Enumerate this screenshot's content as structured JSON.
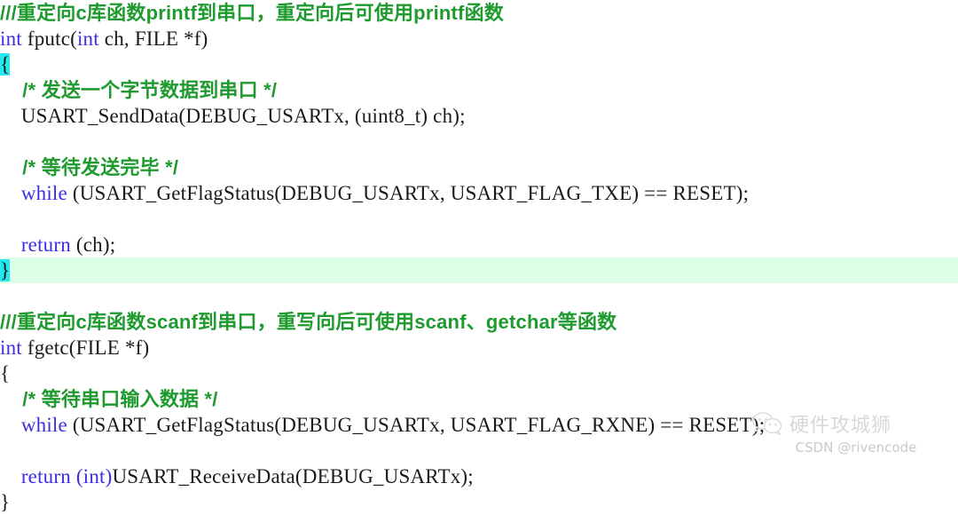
{
  "editor": {
    "background_color": "#ffffff",
    "highlight_line_color": "#ddffe6",
    "brace_match_color": "#22e8f0",
    "comment_color": "#1f9a2e",
    "keyword_color": "#3b2fe0",
    "text_color": "#1a1a1a",
    "language": "C"
  },
  "code": {
    "lines": [
      {
        "n": 1,
        "highlight": false,
        "tokens": [
          {
            "t": "comment",
            "s": "///重定向c库函数printf到串口，重定向后可使用printf函数"
          }
        ]
      },
      {
        "n": 2,
        "highlight": false,
        "tokens": [
          {
            "t": "keyword",
            "s": "int"
          },
          {
            "t": "plain",
            "s": " fputc("
          },
          {
            "t": "keyword",
            "s": "int"
          },
          {
            "t": "plain",
            "s": " ch, FILE *f)"
          }
        ]
      },
      {
        "n": 3,
        "highlight": false,
        "tokens": [
          {
            "t": "brace-hl",
            "s": "{"
          }
        ]
      },
      {
        "n": 4,
        "highlight": false,
        "tokens": [
          {
            "t": "comment",
            "s": "    /* 发送一个字节数据到串口 */"
          }
        ]
      },
      {
        "n": 5,
        "highlight": false,
        "tokens": [
          {
            "t": "plain",
            "s": "    USART_SendData(DEBUG_USARTx, (uint8_t) ch);"
          }
        ]
      },
      {
        "n": 6,
        "highlight": false,
        "tokens": [
          {
            "t": "plain",
            "s": " "
          }
        ]
      },
      {
        "n": 7,
        "highlight": false,
        "tokens": [
          {
            "t": "comment",
            "s": "    /* 等待发送完毕 */"
          }
        ]
      },
      {
        "n": 8,
        "highlight": false,
        "tokens": [
          {
            "t": "plain",
            "s": "    "
          },
          {
            "t": "keyword",
            "s": "while"
          },
          {
            "t": "plain",
            "s": " (USART_GetFlagStatus(DEBUG_USARTx, USART_FLAG_TXE) == RESET);"
          }
        ]
      },
      {
        "n": 9,
        "highlight": false,
        "tokens": [
          {
            "t": "plain",
            "s": " "
          }
        ]
      },
      {
        "n": 10,
        "highlight": false,
        "tokens": [
          {
            "t": "plain",
            "s": "    "
          },
          {
            "t": "keyword",
            "s": "return"
          },
          {
            "t": "plain",
            "s": " (ch);"
          }
        ]
      },
      {
        "n": 11,
        "highlight": true,
        "tokens": [
          {
            "t": "brace-hl",
            "s": "}"
          }
        ]
      },
      {
        "n": 12,
        "highlight": false,
        "tokens": [
          {
            "t": "plain",
            "s": " "
          }
        ]
      },
      {
        "n": 13,
        "highlight": false,
        "tokens": [
          {
            "t": "comment",
            "s": "///重定向c库函数scanf到串口，重写向后可使用scanf、getchar等函数"
          }
        ]
      },
      {
        "n": 14,
        "highlight": false,
        "tokens": [
          {
            "t": "keyword",
            "s": "int"
          },
          {
            "t": "plain",
            "s": " fgetc(FILE *f)"
          }
        ]
      },
      {
        "n": 15,
        "highlight": false,
        "tokens": [
          {
            "t": "plain",
            "s": "{"
          }
        ]
      },
      {
        "n": 16,
        "highlight": false,
        "tokens": [
          {
            "t": "comment",
            "s": "    /* 等待串口输入数据 */"
          }
        ]
      },
      {
        "n": 17,
        "highlight": false,
        "tokens": [
          {
            "t": "plain",
            "s": "    "
          },
          {
            "t": "keyword",
            "s": "while"
          },
          {
            "t": "plain",
            "s": " (USART_GetFlagStatus(DEBUG_USARTx, USART_FLAG_RXNE) == RESET);"
          }
        ]
      },
      {
        "n": 18,
        "highlight": false,
        "tokens": [
          {
            "t": "plain",
            "s": " "
          }
        ]
      },
      {
        "n": 19,
        "highlight": false,
        "tokens": [
          {
            "t": "plain",
            "s": "    "
          },
          {
            "t": "keyword",
            "s": "return"
          },
          {
            "t": "plain",
            "s": " "
          },
          {
            "t": "keyword",
            "s": "(int)"
          },
          {
            "t": "plain",
            "s": "USART_ReceiveData(DEBUG_USARTx);"
          }
        ]
      },
      {
        "n": 20,
        "highlight": false,
        "tokens": [
          {
            "t": "plain",
            "s": "}"
          }
        ]
      }
    ]
  },
  "watermark": {
    "icon": "wechat-icon",
    "brand": "硬件攻城狮",
    "credit": "CSDN @rivencode",
    "color": "#d8d8d8"
  }
}
